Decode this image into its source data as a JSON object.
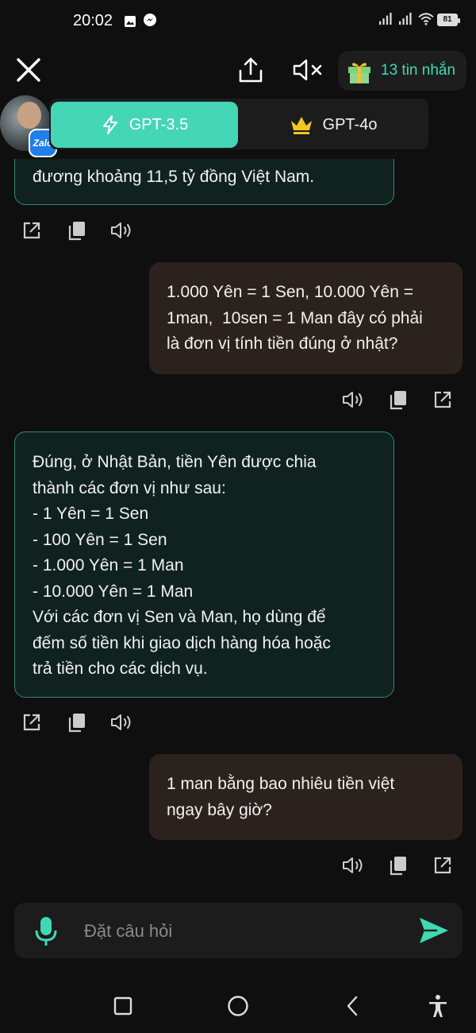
{
  "status_bar": {
    "time": "20:02",
    "battery": "81",
    "icons": [
      "image-icon",
      "messenger-icon",
      "signal-icon",
      "signal-icon",
      "wifi-icon",
      "battery-icon"
    ]
  },
  "top_bar": {
    "icons": [
      "close-icon",
      "share-icon",
      "mute-icon",
      "gift-icon"
    ],
    "messages_left": "13 tin nhắn"
  },
  "model_switch": {
    "active": "GPT-3.5",
    "premium": "GPT-4o",
    "accent": "#45d6b6",
    "crown_color": "#f4c623"
  },
  "overlay": {
    "badge": "Zalo"
  },
  "messages": [
    {
      "role": "bot",
      "lines": [
        "đương khoảng 11,5 tỷ đồng Việt Nam."
      ]
    },
    {
      "role": "user",
      "lines": [
        "1.000 Yên = 1 Sen, 10.000 Yên =",
        "1man,  10sen = 1 Man đây có phải",
        "là đơn vị tính tiền đúng ở nhật?"
      ]
    },
    {
      "role": "bot",
      "lines": [
        "Đúng, ở Nhật Bản, tiền Yên được chia",
        "thành các đơn vị như sau:",
        "- 1 Yên = 1 Sen",
        "- 100 Yên = 1 Sen",
        "- 1.000 Yên = 1 Man",
        "- 10.000 Yên = 1 Man",
        "Với các đơn vị Sen và Man, họ dùng để",
        "đếm số tiền khi giao dịch hàng hóa hoặc",
        "trả tiền cho các dịch vụ."
      ]
    },
    {
      "role": "user",
      "lines": [
        "1 man bằng bao nhiêu tiền việt",
        "ngay bây giờ?"
      ]
    }
  ],
  "message_actions": {
    "bot": [
      "open-external-icon",
      "copy-icon",
      "speaker-icon"
    ],
    "user": [
      "speaker-icon",
      "copy-icon",
      "open-external-icon"
    ]
  },
  "composer": {
    "placeholder": "Đặt câu hỏi",
    "value": "",
    "mic_color": "#3fd9b4",
    "send_color": "#3fd9b4"
  },
  "nav_bar": {
    "icons": [
      "recents-icon",
      "home-icon",
      "back-icon",
      "accessibility-icon"
    ]
  }
}
